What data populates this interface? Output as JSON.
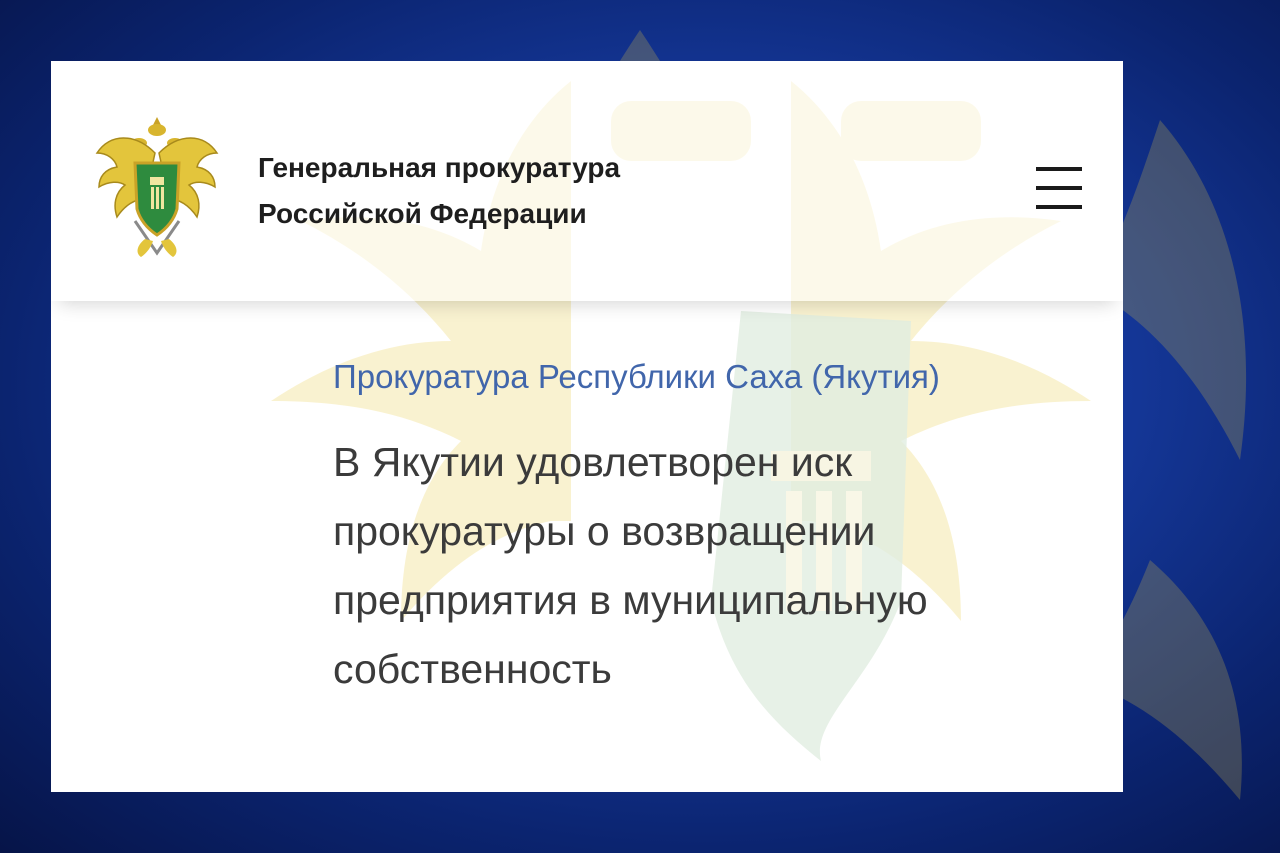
{
  "header": {
    "org_name_line1": "Генеральная прокуратура",
    "org_name_line2": "Российской Федерации",
    "logo_icon": "prosecutor-emblem-icon",
    "menu_icon": "hamburger-menu-icon"
  },
  "article": {
    "source": "Прокуратура Республики Саха (Якутия)",
    "title": "В Якутии удовлетворен иск прокуратуры о возвращении предприятия в муниципальную собственность"
  },
  "colors": {
    "background": "#163a9e",
    "card": "#ffffff",
    "source_link": "#4166ab",
    "title_text": "#3b3b3b",
    "emblem_gold": "#e8d44a",
    "emblem_green": "#2e8b3e"
  }
}
